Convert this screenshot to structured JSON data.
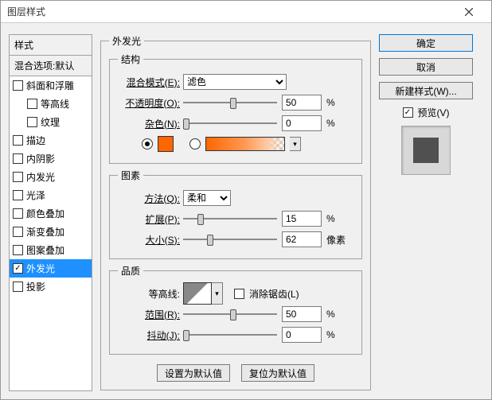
{
  "title": "图层样式",
  "sidebar": {
    "header": "样式",
    "subheader": "混合选项:默认",
    "items": [
      {
        "label": "斜面和浮雕",
        "checked": false,
        "selected": false,
        "indent": false
      },
      {
        "label": "等高线",
        "checked": false,
        "selected": false,
        "indent": true
      },
      {
        "label": "纹理",
        "checked": false,
        "selected": false,
        "indent": true
      },
      {
        "label": "描边",
        "checked": false,
        "selected": false,
        "indent": false
      },
      {
        "label": "内阴影",
        "checked": false,
        "selected": false,
        "indent": false
      },
      {
        "label": "内发光",
        "checked": false,
        "selected": false,
        "indent": false
      },
      {
        "label": "光泽",
        "checked": false,
        "selected": false,
        "indent": false
      },
      {
        "label": "颜色叠加",
        "checked": false,
        "selected": false,
        "indent": false
      },
      {
        "label": "渐变叠加",
        "checked": false,
        "selected": false,
        "indent": false
      },
      {
        "label": "图案叠加",
        "checked": false,
        "selected": false,
        "indent": false
      },
      {
        "label": "外发光",
        "checked": true,
        "selected": true,
        "indent": false
      },
      {
        "label": "投影",
        "checked": false,
        "selected": false,
        "indent": false
      }
    ]
  },
  "panel": {
    "title": "外发光",
    "structure": {
      "legend": "结构",
      "blend_label": "混合模式(E):",
      "blend_value": "滤色",
      "opacity_label": "不透明度(O):",
      "opacity_value": "50",
      "opacity_unit": "%",
      "noise_label": "杂色(N):",
      "noise_value": "0",
      "noise_unit": "%"
    },
    "elements": {
      "legend": "图素",
      "technique_label": "方法(Q):",
      "technique_value": "柔和",
      "spread_label": "扩展(P):",
      "spread_value": "15",
      "spread_unit": "%",
      "size_label": "大小(S):",
      "size_value": "62",
      "size_unit": "像素"
    },
    "quality": {
      "legend": "品质",
      "contour_label": "等高线:",
      "aa_label": "消除锯齿(L)",
      "range_label": "范围(R):",
      "range_value": "50",
      "range_unit": "%",
      "jitter_label": "抖动(J):",
      "jitter_value": "0",
      "jitter_unit": "%"
    },
    "buttons": {
      "make_default": "设置为默认值",
      "reset_default": "复位为默认值"
    }
  },
  "right": {
    "ok": "确定",
    "cancel": "取消",
    "new_style": "新建样式(W)...",
    "preview": "预览(V)"
  }
}
